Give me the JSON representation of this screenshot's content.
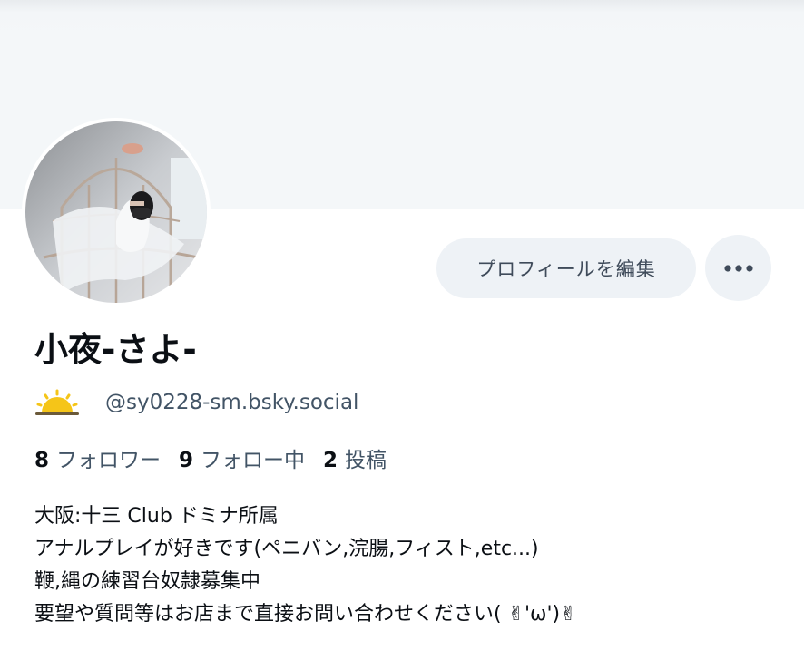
{
  "profile": {
    "display_name": "小夜-さよ-",
    "handle_emoji_icon": "sun-behind-cloud-icon",
    "handle": "@sy0228-sm.bsky.social",
    "edit_profile_label": "プロフィールを編集",
    "more_icon": "ellipsis-icon",
    "stats": {
      "followers_count": "8",
      "followers_label": "フォロワー",
      "following_count": "9",
      "following_label": "フォロー中",
      "posts_count": "2",
      "posts_label": "投稿"
    },
    "bio": [
      "大阪:十三 Club ドミナ所属",
      "アナルプレイが好きです(ペニバン,浣腸,フィスト,etc...)",
      "鞭,縄の練習台奴隷募集中",
      "要望や質問等はお店まで直接お問い合わせください( ✌'ω')✌"
    ]
  },
  "colors": {
    "banner": "#f4f7f9",
    "button_bg": "#eef2f6",
    "secondary_text": "#425466",
    "primary_text": "#0b0f14",
    "sun_icon": "#f5c518"
  }
}
